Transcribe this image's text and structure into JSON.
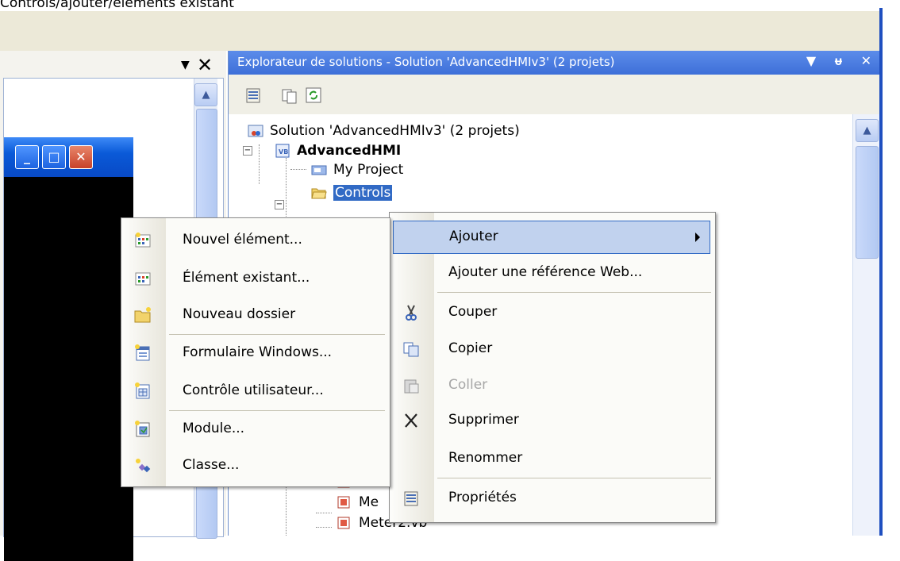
{
  "caption": "Controls/ajouter/éléments existant",
  "left_panel": {
    "scroll_up_glyph": "▲",
    "dropdown_glyph": "▼",
    "close_glyph": "✕",
    "window_buttons": {
      "minimize": "_",
      "maximize": "□",
      "close": "✕"
    }
  },
  "solution_explorer": {
    "title": "Explorateur de solutions - Solution 'AdvancedHMIv3' (2 projets)",
    "title_icons": {
      "dropdown": "▼",
      "pin": "ᵾ",
      "close": "✕"
    },
    "toolbar": [
      "properties-icon",
      "show-all-files-icon",
      "refresh-icon"
    ],
    "tree": [
      {
        "label": "Solution 'AdvancedHMIv3' (2 projets)",
        "icon": "solution-icon",
        "bold": false
      },
      {
        "label": "AdvancedHMI",
        "icon": "vb-project-icon",
        "bold": true,
        "expander": "−"
      },
      {
        "label": "My Project",
        "icon": "my-project-icon",
        "bold": false
      },
      {
        "label": "Controls",
        "icon": "folder-open-icon",
        "bold": false,
        "selected": true,
        "expander": "−"
      },
      {
        "label": "Me",
        "icon": "vb-file-icon",
        "bold": false
      },
      {
        "label": "Me",
        "icon": "vb-file-icon",
        "bold": false
      },
      {
        "label": "Meter2.vb",
        "icon": "vb-file-icon",
        "bold": false
      }
    ]
  },
  "context_menu": {
    "items": [
      {
        "label": "Ajouter",
        "icon": "",
        "submenu": true,
        "highlight": true
      },
      {
        "label": "Ajouter une référence Web...",
        "icon": ""
      },
      {
        "label": "Couper",
        "icon": "cut-icon"
      },
      {
        "label": "Copier",
        "icon": "copy-icon"
      },
      {
        "label": "Coller",
        "icon": "paste-icon",
        "disabled": true
      },
      {
        "label": "Supprimer",
        "icon": "delete-icon"
      },
      {
        "label": "Renommer",
        "icon": ""
      },
      {
        "label": "Propriétés",
        "icon": "properties-icon"
      }
    ]
  },
  "submenu": {
    "items": [
      {
        "label": "Nouvel élément...",
        "icon": "new-item-icon"
      },
      {
        "label": "Élément existant...",
        "icon": "existing-item-icon"
      },
      {
        "label": "Nouveau dossier",
        "icon": "new-folder-icon"
      },
      {
        "label": "Formulaire Windows...",
        "icon": "windows-form-icon"
      },
      {
        "label": "Contrôle utilisateur...",
        "icon": "user-control-icon"
      },
      {
        "label": "Module...",
        "icon": "module-icon"
      },
      {
        "label": "Classe...",
        "icon": "class-icon"
      }
    ]
  },
  "colors": {
    "xp_blue": "#0a5ad8",
    "selection": "#316ac5",
    "menu_highlight": "#c1d2ee"
  }
}
